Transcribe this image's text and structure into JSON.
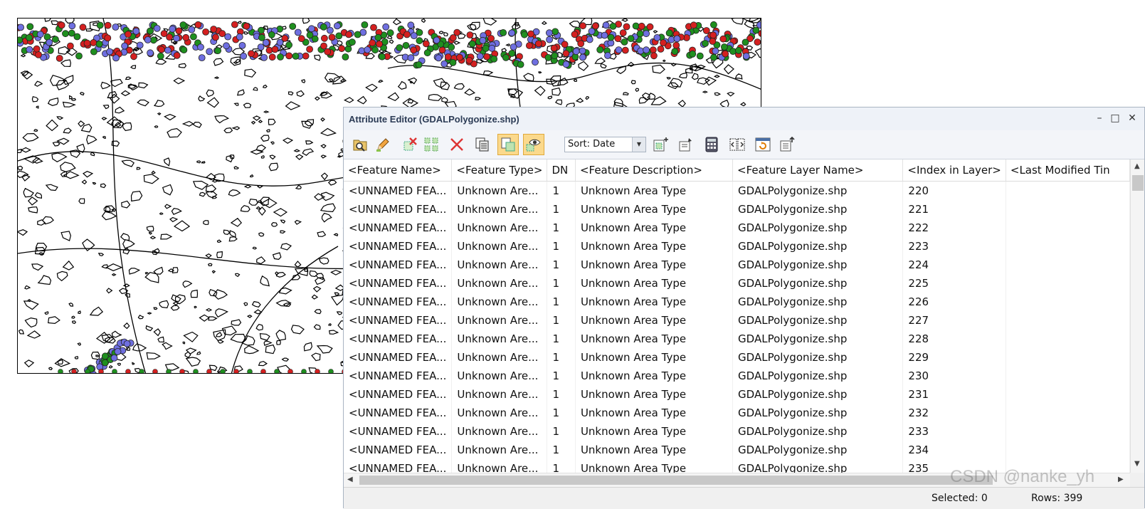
{
  "window": {
    "title": "Attribute Editor (GDALPolygonize.shp)",
    "minimize": "–",
    "maximize": "□",
    "close": "✕"
  },
  "toolbar": {
    "sort_label": "Sort: Date",
    "tools": [
      {
        "icon": "search-folder-icon",
        "active": false
      },
      {
        "icon": "edit-pencil-icon",
        "active": false
      },
      {
        "icon": "delete-selected-icon",
        "active": false
      },
      {
        "icon": "select-all-icon",
        "active": false
      },
      {
        "icon": "clear-selection-icon",
        "active": false
      },
      {
        "icon": "copy-icon",
        "active": false
      },
      {
        "icon": "show-selected-only-icon",
        "active": true
      },
      {
        "icon": "view-eye-icon",
        "active": true
      }
    ],
    "tools_right": [
      {
        "icon": "add-column-icon"
      },
      {
        "icon": "edit-column-icon"
      },
      {
        "icon": "calculator-icon"
      },
      {
        "icon": "split-icon"
      },
      {
        "icon": "refresh-icon"
      },
      {
        "icon": "export-icon"
      }
    ]
  },
  "table": {
    "columns": [
      "<Feature Name>",
      "<Feature Type>",
      "DN",
      "<Feature Description>",
      "<Feature Layer Name>",
      "<Index in Layer>",
      "<Last Modified Tin"
    ],
    "rows": [
      [
        "<UNNAMED FEA...",
        "Unknown Are...",
        "1",
        "Unknown Area Type",
        "GDALPolygonize.shp",
        "220",
        ""
      ],
      [
        "<UNNAMED FEA...",
        "Unknown Are...",
        "1",
        "Unknown Area Type",
        "GDALPolygonize.shp",
        "221",
        ""
      ],
      [
        "<UNNAMED FEA...",
        "Unknown Are...",
        "1",
        "Unknown Area Type",
        "GDALPolygonize.shp",
        "222",
        ""
      ],
      [
        "<UNNAMED FEA...",
        "Unknown Are...",
        "1",
        "Unknown Area Type",
        "GDALPolygonize.shp",
        "223",
        ""
      ],
      [
        "<UNNAMED FEA...",
        "Unknown Are...",
        "1",
        "Unknown Area Type",
        "GDALPolygonize.shp",
        "224",
        ""
      ],
      [
        "<UNNAMED FEA...",
        "Unknown Are...",
        "1",
        "Unknown Area Type",
        "GDALPolygonize.shp",
        "225",
        ""
      ],
      [
        "<UNNAMED FEA...",
        "Unknown Are...",
        "1",
        "Unknown Area Type",
        "GDALPolygonize.shp",
        "226",
        ""
      ],
      [
        "<UNNAMED FEA...",
        "Unknown Are...",
        "1",
        "Unknown Area Type",
        "GDALPolygonize.shp",
        "227",
        ""
      ],
      [
        "<UNNAMED FEA...",
        "Unknown Are...",
        "1",
        "Unknown Area Type",
        "GDALPolygonize.shp",
        "228",
        ""
      ],
      [
        "<UNNAMED FEA...",
        "Unknown Are...",
        "1",
        "Unknown Area Type",
        "GDALPolygonize.shp",
        "229",
        ""
      ],
      [
        "<UNNAMED FEA...",
        "Unknown Are...",
        "1",
        "Unknown Area Type",
        "GDALPolygonize.shp",
        "230",
        ""
      ],
      [
        "<UNNAMED FEA...",
        "Unknown Are...",
        "1",
        "Unknown Area Type",
        "GDALPolygonize.shp",
        "231",
        ""
      ],
      [
        "<UNNAMED FEA...",
        "Unknown Are...",
        "1",
        "Unknown Area Type",
        "GDALPolygonize.shp",
        "232",
        ""
      ],
      [
        "<UNNAMED FEA...",
        "Unknown Are...",
        "1",
        "Unknown Area Type",
        "GDALPolygonize.shp",
        "233",
        ""
      ],
      [
        "<UNNAMED FEA...",
        "Unknown Are...",
        "1",
        "Unknown Area Type",
        "GDALPolygonize.shp",
        "234",
        ""
      ],
      [
        "<UNNAMED FEA...",
        "Unknown Are...",
        "1",
        "Unknown Area Type",
        "GDALPolygonize.shp",
        "235",
        ""
      ]
    ]
  },
  "status": {
    "selected": "Selected: 0",
    "rows": "Rows: 399"
  },
  "watermark": "CSDN @nanke_yh",
  "colors": {
    "marker_red": "#d42020",
    "marker_green": "#1f8f1f",
    "marker_blue": "#6f6fe0",
    "active_tool": "#fbd98c"
  }
}
